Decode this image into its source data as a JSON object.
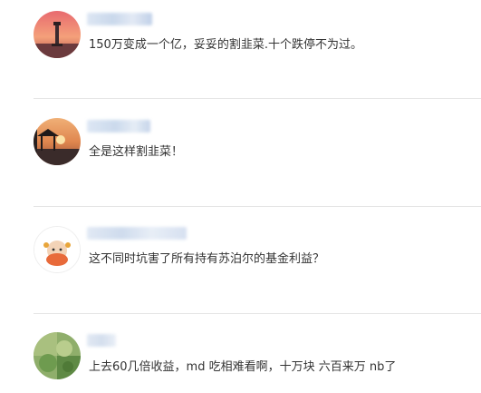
{
  "comments": [
    {
      "text": "150万变成一个亿，妥妥的割韭菜.十个跌停不为过。",
      "avatar": "lighthouse-sunset-avatar"
    },
    {
      "text": "全是这样割韭菜！",
      "avatar": "pavilion-sunset-avatar"
    },
    {
      "text": "这不同时坑害了所有持有苏泊尔的基金利益？",
      "avatar": "cartoon-character-avatar"
    },
    {
      "text": "上去60几倍收益，md 吃相难看啊，十万块 六百来万 nb了",
      "avatar": "green-plant-avatar"
    }
  ],
  "colors": {
    "divider": "#e5e5e5",
    "text": "#333333",
    "username_blur": "#c9d8ec"
  }
}
